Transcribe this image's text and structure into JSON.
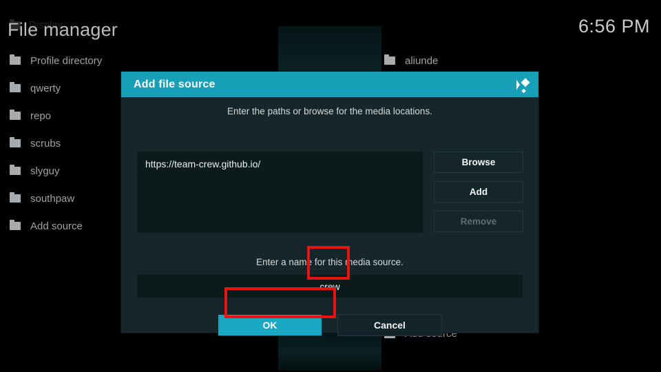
{
  "window": {
    "app": "Kodi",
    "page_title": "File manager",
    "clock": "6:56 PM",
    "ghost_item": "Display"
  },
  "left_list": {
    "items": [
      {
        "label": "Profile directory",
        "icon": "folder-icon"
      },
      {
        "label": "qwerty",
        "icon": "folder-icon"
      },
      {
        "label": "repo",
        "icon": "folder-icon"
      },
      {
        "label": "scrubs",
        "icon": "folder-icon"
      },
      {
        "label": "slyguy",
        "icon": "folder-icon"
      },
      {
        "label": "southpaw",
        "icon": "folder-icon"
      },
      {
        "label": "Add source",
        "icon": "folder-icon"
      }
    ]
  },
  "right_list": {
    "items": [
      {
        "label": "aliunde",
        "icon": "folder-icon"
      }
    ],
    "bottom_item": {
      "label": "Add source",
      "icon": "folder-icon"
    }
  },
  "dialog": {
    "title": "Add file source",
    "logo_icon": "kodi-logo-icon",
    "paths_hint": "Enter the paths or browse for the media locations.",
    "path_value": "https://team-crew.github.io/",
    "side_buttons": [
      {
        "label": "Browse",
        "state": "enabled"
      },
      {
        "label": "Add",
        "state": "enabled"
      },
      {
        "label": "Remove",
        "state": "disabled"
      }
    ],
    "name_hint": "Enter a name for this media source.",
    "name_value": "crew",
    "actions": {
      "ok": "OK",
      "cancel": "Cancel"
    }
  },
  "colors": {
    "accent": "#18a0b8",
    "ok_button": "#18a8c4",
    "dialog_bg": "#16262a",
    "field_bg": "#0c1a1a",
    "annotation": "#e81414",
    "screen_bg": "#000000"
  }
}
